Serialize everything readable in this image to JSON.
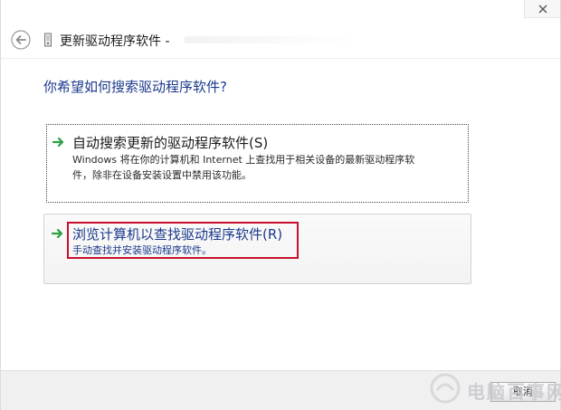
{
  "window": {
    "title": "更新驱动程序软件 -"
  },
  "question": "你希望如何搜索驱动程序软件?",
  "options": [
    {
      "title": "自动搜索更新的驱动程序软件(S)",
      "description_line1": "Windows 将在你的计算机和 Internet 上查找用于相关设备的最新驱动程序软",
      "description_line2": "件，除非在设备安装设置中禁用该功能。"
    },
    {
      "title": "浏览计算机以查找驱动程序软件(R)",
      "description": "手动查找并安装驱动程序软件。"
    }
  ],
  "footer": {
    "cancel_label": "取消"
  },
  "watermark": {
    "text": "电脑百事网"
  },
  "colors": {
    "accent_blue": "#1c3a8c",
    "arrow_green": "#2ea043",
    "highlight_red": "#c8102e"
  },
  "icons": {
    "back": "back-arrow-icon",
    "device": "device-icon",
    "option_arrow": "green-arrow-icon",
    "close": "close-icon"
  }
}
